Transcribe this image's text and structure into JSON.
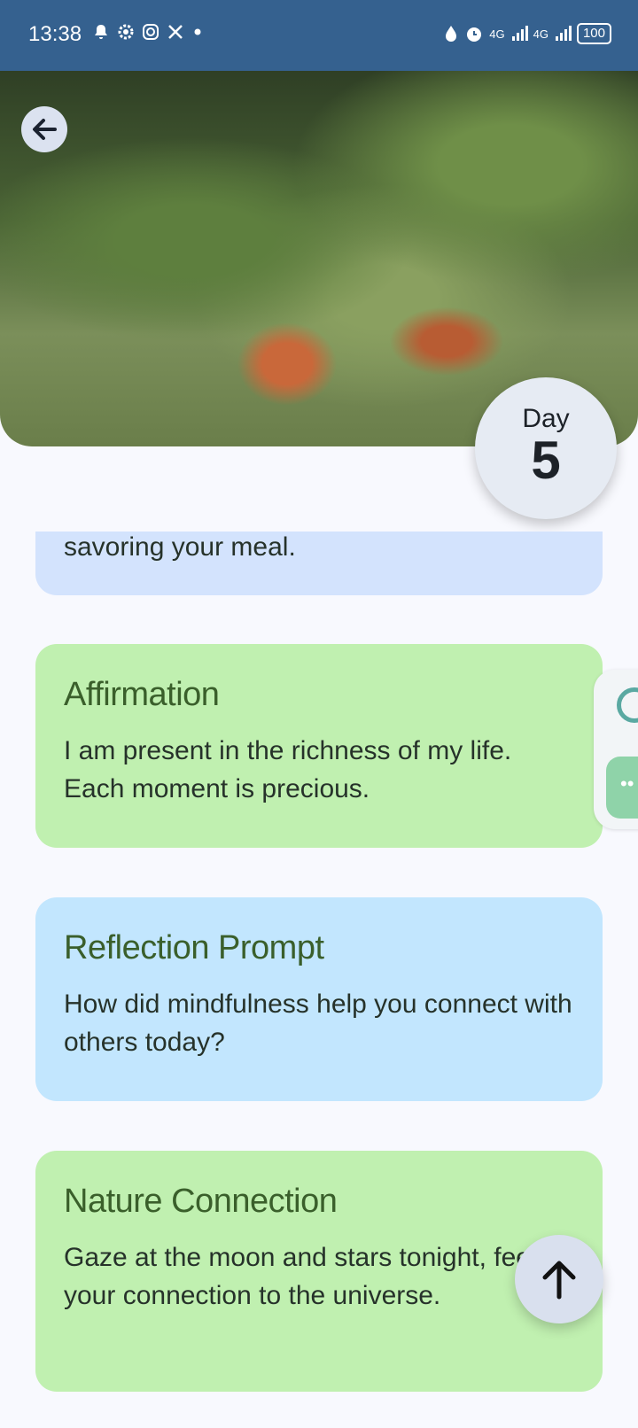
{
  "status_bar": {
    "time": "13:38",
    "network_1": "4G",
    "network_2": "4G",
    "battery": "100",
    "left_icons": [
      "alarm-bell-icon",
      "settings-gear-icon",
      "instagram-icon",
      "x-icon",
      "dot-icon"
    ],
    "right_icons": [
      "water-drop-icon",
      "alarm-clock-icon",
      "signal-icon",
      "signal-icon",
      "battery-icon"
    ]
  },
  "hero": {
    "back_icon": "arrow-left-icon",
    "day_label": "Day",
    "day_number": "5"
  },
  "cards": {
    "partial_text": "savoring your meal.",
    "affirmation_title": "Affirmation",
    "affirmation_text": "I am present in the richness of my life. Each moment is precious.",
    "reflection_title": "Reflection Prompt",
    "reflection_text": "How did mindfulness help you connect with others today?",
    "nature_title": "Nature Connection",
    "nature_text": "Gaze at the moon and stars tonight, feeling your connection to the universe."
  },
  "actions": {
    "scroll_top_icon": "arrow-up-icon"
  },
  "colors": {
    "status_bar": "#35618f",
    "card_green": "#c0f0b0",
    "card_blue": "#c2e6fe",
    "card_partial": "#d3e3fd",
    "title_green": "#3a5f2b"
  }
}
